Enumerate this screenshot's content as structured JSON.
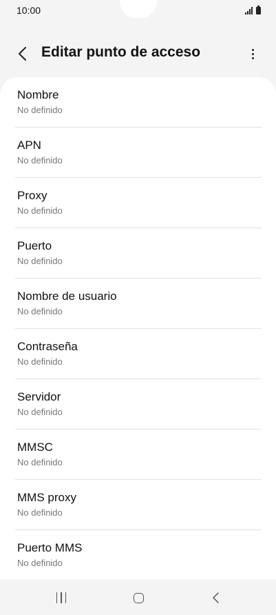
{
  "status_bar": {
    "time": "10:00",
    "signal_icon": "signal-icon",
    "battery_icon": "battery-icon"
  },
  "header": {
    "title": "Editar punto de acceso",
    "back_icon": "chevron-left-icon",
    "more_icon": "more-vertical-icon"
  },
  "list": {
    "items": [
      {
        "label": "Nombre",
        "value": "No definido"
      },
      {
        "label": "APN",
        "value": "No definido"
      },
      {
        "label": "Proxy",
        "value": "No definido"
      },
      {
        "label": "Puerto",
        "value": "No definido"
      },
      {
        "label": "Nombre de usuario",
        "value": "No definido"
      },
      {
        "label": "Contraseña",
        "value": "No definido"
      },
      {
        "label": "Servidor",
        "value": "No definido"
      },
      {
        "label": "MMSC",
        "value": "No definido"
      },
      {
        "label": "MMS proxy",
        "value": "No definido"
      },
      {
        "label": "Puerto MMS",
        "value": "No definido"
      }
    ]
  },
  "nav_bar": {
    "recents_icon": "recents-icon",
    "home_icon": "home-icon",
    "back_icon": "back-icon"
  },
  "colors": {
    "background": "#f4f4f4",
    "card": "#ffffff",
    "text_primary": "#111111",
    "text_secondary": "#777777",
    "divider": "#e2e2e2"
  }
}
